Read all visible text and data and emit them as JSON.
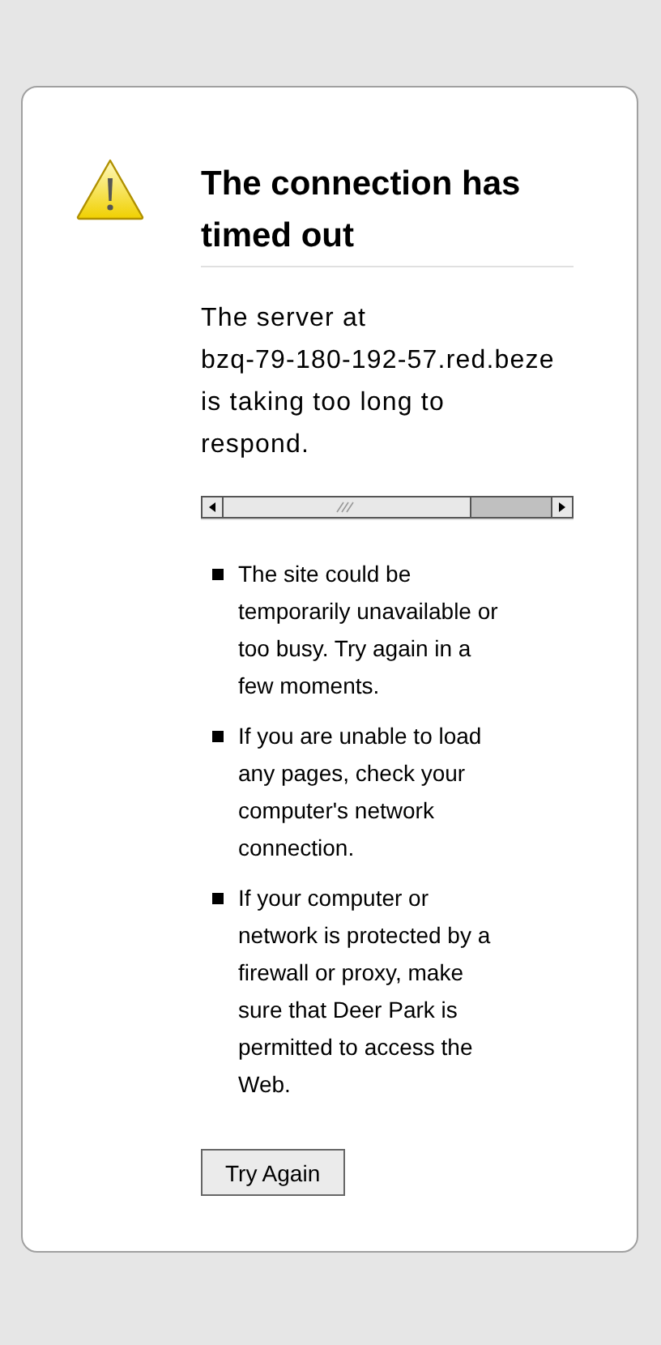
{
  "title": "The connection has timed out",
  "message_lines": [
    "The server at",
    "bzq-79-180-192-57.red.beze",
    "is taking too long to",
    "respond."
  ],
  "suggestions": [
    "The site could be temporarily unavailable or too busy. Try again in a few moments.",
    "If you are unable to load any pages, check your computer's network connection.",
    "If your computer or network is protected by a firewall or proxy, make sure that Deer Park is permitted to access the Web."
  ],
  "button": "Try Again"
}
